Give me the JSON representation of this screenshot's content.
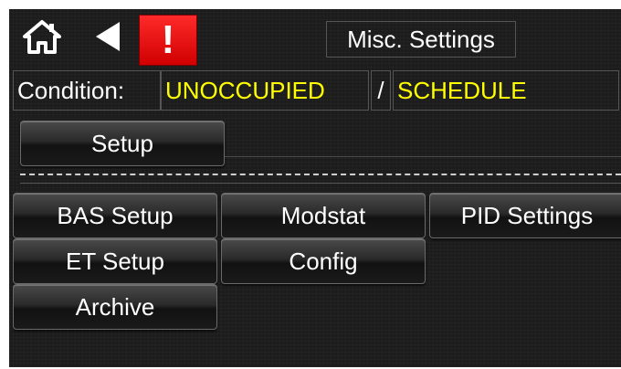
{
  "header": {
    "title": "Misc. Settings",
    "icons": {
      "home": "home-icon",
      "back": "back-arrow-icon",
      "alert": "alert-icon"
    },
    "alert_mark": "!"
  },
  "condition": {
    "label": "Condition:",
    "occupancy": "UNOCCUPIED",
    "separator": "/",
    "mode": "SCHEDULE"
  },
  "setup_button": "Setup",
  "menu": {
    "bas_setup": "BAS Setup",
    "modstat": "Modstat",
    "pid_settings": "PID Settings",
    "et_setup": "ET Setup",
    "config": "Config",
    "archive": "Archive"
  },
  "colors": {
    "background": "#1c1c1c",
    "alert": "#e00000",
    "condition_value": "#ffff00",
    "text": "#ffffff"
  }
}
